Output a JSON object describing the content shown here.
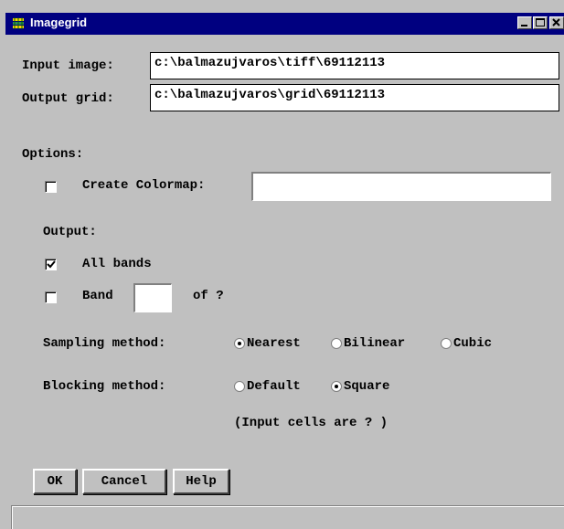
{
  "window": {
    "title": "Imagegrid"
  },
  "input_image": {
    "label": "Input image:",
    "value": "c:\\balmazujvaros\\tiff\\69112113"
  },
  "output_grid": {
    "label": "Output grid:",
    "value": "c:\\balmazujvaros\\grid\\69112113"
  },
  "options": {
    "heading": "Options:",
    "create_colormap": {
      "label": "Create Colormap:",
      "checked": false,
      "value": ""
    }
  },
  "output": {
    "heading": "Output:",
    "all_bands": {
      "label": "All bands",
      "checked": true
    },
    "band": {
      "label": "Band",
      "checked": false,
      "value": "",
      "of_label": "of ?"
    }
  },
  "sampling": {
    "label": "Sampling method:",
    "options": [
      "Nearest",
      "Bilinear",
      "Cubic"
    ],
    "selected": "Nearest"
  },
  "blocking": {
    "label": "Blocking method:",
    "options": [
      "Default",
      "Square"
    ],
    "selected": "Square",
    "note": "(Input cells are ? )"
  },
  "buttons": {
    "ok": "OK",
    "cancel": "Cancel",
    "help": "Help"
  },
  "status": {
    "text": ""
  }
}
